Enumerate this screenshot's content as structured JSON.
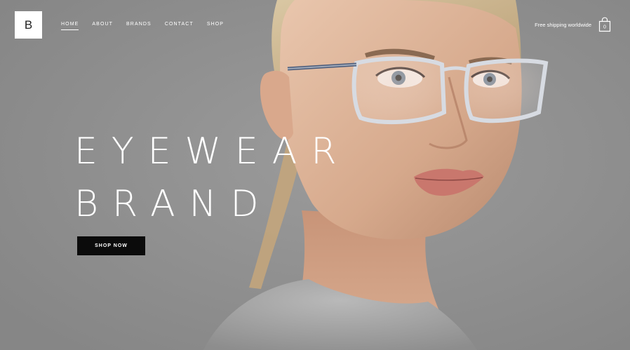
{
  "brand": {
    "logo_letter": "B"
  },
  "nav": {
    "items": [
      {
        "label": "HOME",
        "active": true
      },
      {
        "label": "ABOUT",
        "active": false
      },
      {
        "label": "BRANDS",
        "active": false
      },
      {
        "label": "CONTACT",
        "active": false
      },
      {
        "label": "SHOP",
        "active": false
      }
    ]
  },
  "header": {
    "shipping_text": "Free shipping worldwide",
    "cart_count": "0",
    "cart_icon": "shopping-bag-icon"
  },
  "hero": {
    "headline_line1": "EYEWEAR",
    "headline_line2": "BRAND",
    "cta_label": "SHOP NOW",
    "image": "woman-wearing-eyeglasses-photo"
  },
  "colors": {
    "background": "#8f8f8f",
    "text": "#ffffff",
    "button": "#0b0b0b",
    "logo_bg": "#ffffff"
  }
}
